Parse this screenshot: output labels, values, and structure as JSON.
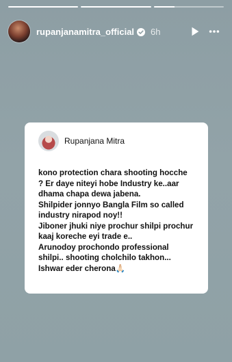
{
  "story": {
    "progress": [
      1,
      1,
      0.3
    ],
    "header": {
      "username": "rupanjanamitra_official",
      "time": "6h",
      "icons": {
        "verified": "verified-badge-icon",
        "play": "play-icon",
        "more": "more-options-icon"
      }
    },
    "card": {
      "author": "Rupanjana Mitra",
      "text": "kono protection chara shooting hocche ? Er daye niteyi hobe Industry ke..aar dhama chapa dewa jabena.\nShilpider jonnyo Bangla Film so called industry nirapod noy!!\nJiboner jhuki niye prochur shilpi prochur kaaj koreche eyi trade e..\nArunodoy prochondo professional shilpi.. shooting cholchilo takhon...\nIshwar eder cherona🙏🏻"
    }
  }
}
